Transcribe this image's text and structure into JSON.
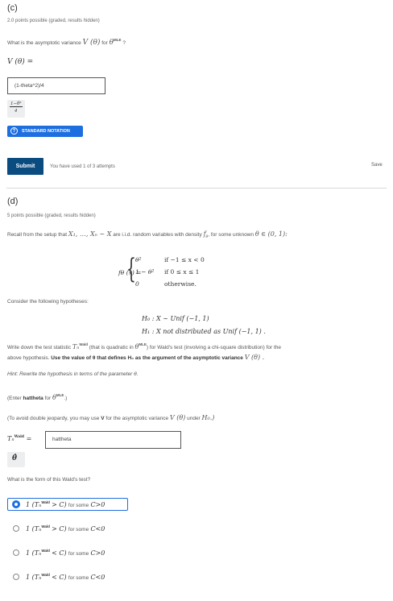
{
  "part_c": {
    "label": "(c)",
    "meta": "2.0 points possible (graded, results hidden)",
    "question": "What is the asymptotic variance",
    "question_sym": "V (θ)",
    "question_for": "for",
    "question_theta": "θ",
    "question_sup": "MLE",
    "question_end": "?",
    "answer_label": "V (θ) =",
    "answer_value": "(1-theta^2)/4",
    "preview_num": "1−θ²",
    "preview_den": "4",
    "notation_button": "STANDARD NOTATION",
    "submit": "Submit",
    "attempts": "You have used 1 of 3 attempts",
    "save": "Save"
  },
  "part_d": {
    "label": "(d)",
    "meta": "5 points possible (graded, results hidden)",
    "setup": "Recall from the setup that",
    "setup_vars": "X₁, …, Xₙ ∼ X",
    "setup_mid": "are i.i.d. random variables with density",
    "setup_f": "f_θ",
    "setup_end": ", for some unknown",
    "setup_domain": "θ ∈ (0, 1):",
    "density_lhs": "fθ (x) =",
    "cases": [
      {
        "expr": "θ²",
        "cond": "if  −1 ≤ x < 0"
      },
      {
        "expr": "1 − θ²",
        "cond": "if 0 ≤ x ≤ 1"
      },
      {
        "expr": "0",
        "cond": "otherwise."
      }
    ],
    "consider": "Consider the following hypotheses:",
    "h0": "H₀  : X ∼ Unif (−1, 1)",
    "h1": "H₁  : X not distributed as Unif (−1, 1) .",
    "instr_1": "Write down the test statistic",
    "instr_T": "Tₙ",
    "instr_Tsup": "Wald",
    "instr_2": "(that is quadratic in",
    "instr_theta": "θ",
    "instr_sup": "MLE",
    "instr_3": ") for Wald's test (involving a chi-square distribution) for the",
    "instr_line2a": "above hypothesis.",
    "instr_line2b": "Use the value of θ that defines H₀ as the argument of the asymptotic variance",
    "instr_line2c": "V (θ) .",
    "hint": "Hint: Rewrite the hypothesis in terms of the parameter θ.",
    "enter_1": "(Enter",
    "enter_bold": "hattheta",
    "enter_2": "for",
    "enter_theta": "θ",
    "enter_sup": "MLE",
    "enter_3": ".)",
    "avoid": "(To avoid double jeopardy, you may use",
    "avoid_V": "V",
    "avoid_2": "for the asymptotic variance",
    "avoid_sym": "V (θ)",
    "avoid_3": "under",
    "avoid_h0": "H₀.)",
    "t_label": "Tₙ",
    "t_sup": "Wald",
    "t_eq": "=",
    "t_value": "hattheta",
    "preview": "θ̂",
    "form_q": "What is the form of this Wald's test?",
    "options": [
      {
        "lhs": "1 (Tₙ",
        "sup": "Wald",
        "op": "> C)",
        "tail": "for some",
        "cond": "C>0",
        "selected": true
      },
      {
        "lhs": "1 (Tₙ",
        "sup": "Wald",
        "op": "> C)",
        "tail": "for some",
        "cond": "C<0",
        "selected": false
      },
      {
        "lhs": "1 (Tₙ",
        "sup": "Wald",
        "op": "< C)",
        "tail": "for some",
        "cond": "C>0",
        "selected": false
      },
      {
        "lhs": "1 (Tₙ",
        "sup": "Wald",
        "op": "< C)",
        "tail": "for some",
        "cond": "C<0",
        "selected": false
      }
    ]
  },
  "colors": {
    "accent": "#1d6ee0",
    "submit": "#0a4b80"
  }
}
